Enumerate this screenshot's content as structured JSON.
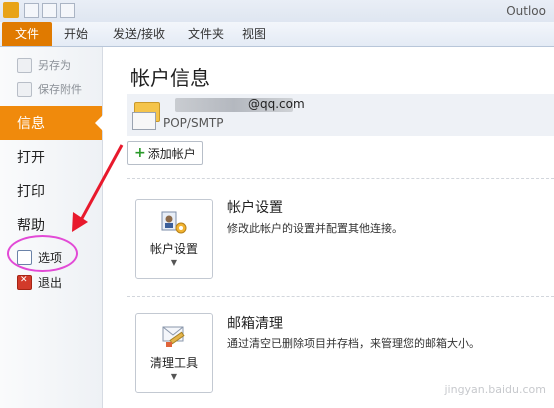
{
  "window": {
    "title": "Outloo"
  },
  "ribbon": {
    "tabs": [
      "文件",
      "开始",
      "发送/接收",
      "文件夹",
      "视图"
    ]
  },
  "nav": {
    "save_as": "另存为",
    "save_attachments": "保存附件",
    "info": "信息",
    "open": "打开",
    "print": "打印",
    "help": "帮助",
    "options": "选项",
    "exit": "退出"
  },
  "main": {
    "heading": "帐户信息",
    "email": "@qq.com",
    "protocol": "POP/SMTP",
    "add_account": "添加帐户",
    "account_settings": {
      "button_label": "帐户设置",
      "title": "帐户设置",
      "description": "修改此帐户的设置并配置其他连接。"
    },
    "cleanup": {
      "button_label": "清理工具",
      "title": "邮箱清理",
      "description": "通过清空已删除项目并存档，来管理您的邮箱大小。"
    }
  },
  "overlay": {
    "annotation_color": "#e24ad6",
    "arrow_color": "#e8192c"
  },
  "watermark": "jingyan.baidu.com"
}
